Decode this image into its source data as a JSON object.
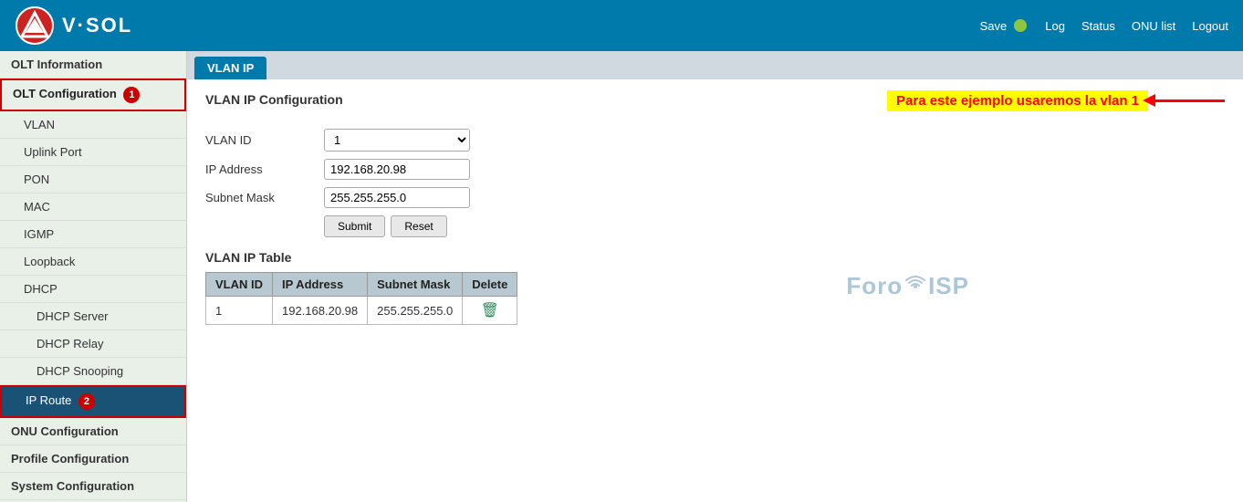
{
  "header": {
    "logo_text": "V·SOL",
    "save_label": "Save",
    "status_dot_color": "#8dc63f",
    "nav": {
      "log": "Log",
      "status": "Status",
      "onu_list": "ONU list",
      "logout": "Logout"
    }
  },
  "sidebar": {
    "items": [
      {
        "id": "olt-info",
        "label": "OLT Information",
        "level": 0,
        "active": false,
        "badge": null
      },
      {
        "id": "olt-config",
        "label": "OLT Configuration",
        "level": 0,
        "active": true,
        "badge": "1"
      },
      {
        "id": "vlan",
        "label": "VLAN",
        "level": 1,
        "active": false,
        "badge": null
      },
      {
        "id": "uplink-port",
        "label": "Uplink Port",
        "level": 1,
        "active": false,
        "badge": null
      },
      {
        "id": "pon",
        "label": "PON",
        "level": 1,
        "active": false,
        "badge": null
      },
      {
        "id": "mac",
        "label": "MAC",
        "level": 1,
        "active": false,
        "badge": null
      },
      {
        "id": "igmp",
        "label": "IGMP",
        "level": 1,
        "active": false,
        "badge": null
      },
      {
        "id": "loopback",
        "label": "Loopback",
        "level": 1,
        "active": false,
        "badge": null
      },
      {
        "id": "dhcp",
        "label": "DHCP",
        "level": 1,
        "active": false,
        "badge": null
      },
      {
        "id": "dhcp-server",
        "label": "DHCP Server",
        "level": 2,
        "active": false,
        "badge": null
      },
      {
        "id": "dhcp-relay",
        "label": "DHCP Relay",
        "level": 2,
        "active": false,
        "badge": null
      },
      {
        "id": "dhcp-snooping",
        "label": "DHCP Snooping",
        "level": 2,
        "active": false,
        "badge": null
      },
      {
        "id": "ip-route",
        "label": "IP Route",
        "level": 1,
        "active": true,
        "badge": "2"
      },
      {
        "id": "onu-config",
        "label": "ONU Configuration",
        "level": 0,
        "active": false,
        "badge": null
      },
      {
        "id": "profile-config",
        "label": "Profile Configuration",
        "level": 0,
        "active": false,
        "badge": null
      },
      {
        "id": "system-config",
        "label": "System Configuration",
        "level": 0,
        "active": false,
        "badge": null
      }
    ]
  },
  "tab": {
    "label": "VLAN IP"
  },
  "main": {
    "section_title": "VLAN IP Configuration",
    "annotation": "Para este ejemplo usaremos la vlan 1",
    "form": {
      "vlan_id_label": "VLAN ID",
      "vlan_id_value": "1",
      "ip_address_label": "IP Address",
      "ip_address_value": "192.168.20.98",
      "subnet_mask_label": "Subnet Mask",
      "subnet_mask_value": "255.255.255.0",
      "submit_label": "Submit",
      "reset_label": "Reset"
    },
    "table": {
      "title": "VLAN IP Table",
      "columns": [
        "VLAN ID",
        "IP Address",
        "Subnet Mask",
        "Delete"
      ],
      "rows": [
        {
          "vlan_id": "1",
          "ip_address": "192.168.20.98",
          "subnet_mask": "255.255.255.0"
        }
      ]
    }
  },
  "watermark": {
    "text_foro": "Foro",
    "text_isp": "ISP"
  }
}
